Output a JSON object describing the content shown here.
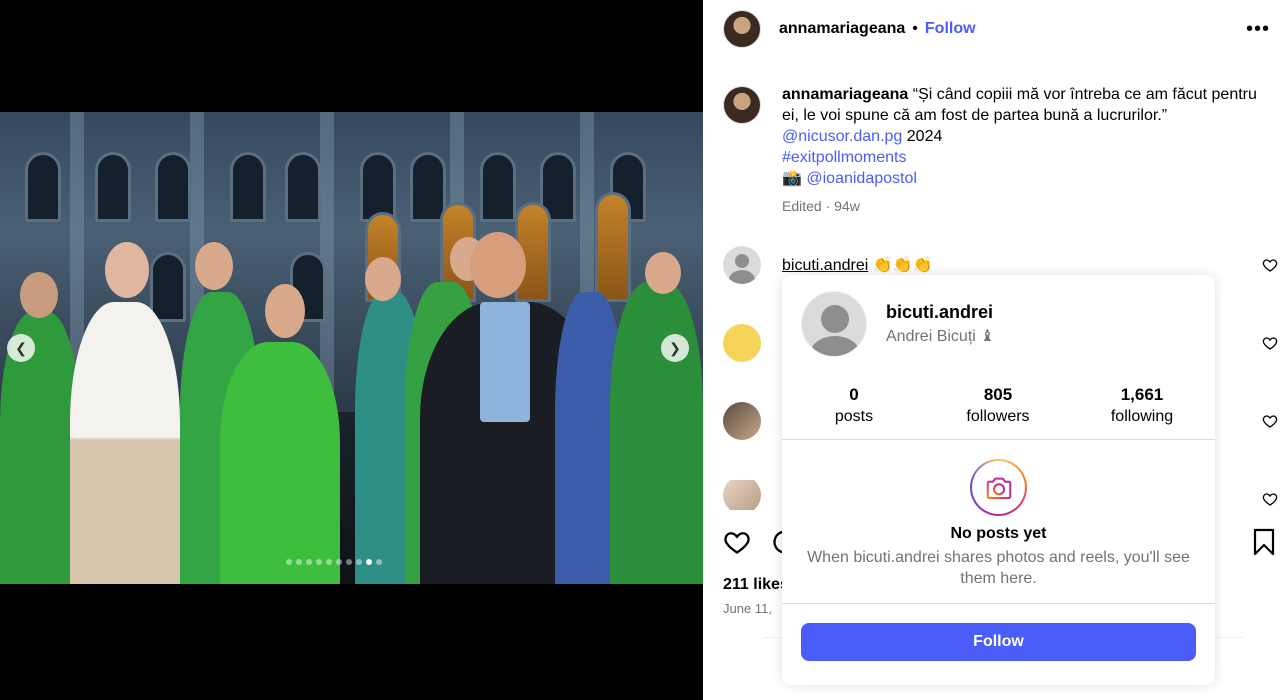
{
  "post": {
    "username": "annamariageana",
    "separator": "•",
    "follow_label": "Follow",
    "more_label": "•••",
    "caption": {
      "username": "annamariageana",
      "text": "“Și când copiii mă vor întreba ce am făcut pentru ei, le voi spune că am fost de partea bună a lucrurilor.”",
      "mention1": "@nicusor.dan.pg",
      "year": "2024",
      "hashtag": "#exitpollmoments",
      "camera_emoji": "📸",
      "mention2": "@ioanidapostol",
      "edited": "Edited · 94w"
    },
    "comments": [
      {
        "username": "bicuti.andrei",
        "text": "👏👏👏"
      }
    ],
    "likes": "211 likes",
    "date": "June 11,"
  },
  "carousel": {
    "prev_icon": "chevron-left-icon",
    "next_icon": "chevron-right-icon",
    "dot_count": 10,
    "active_dot": 8
  },
  "hover_card": {
    "username": "bicuti.andrei",
    "full_name": "Andrei Bicuți ♝",
    "stats": [
      {
        "num": "0",
        "label": "posts"
      },
      {
        "num": "805",
        "label": "followers"
      },
      {
        "num": "1,661",
        "label": "following"
      }
    ],
    "no_posts_title": "No posts yet",
    "no_posts_desc": "When bicuti.andrei shares photos and reels, you'll see them here.",
    "follow_label": "Follow",
    "accent": "#4a5df9"
  }
}
